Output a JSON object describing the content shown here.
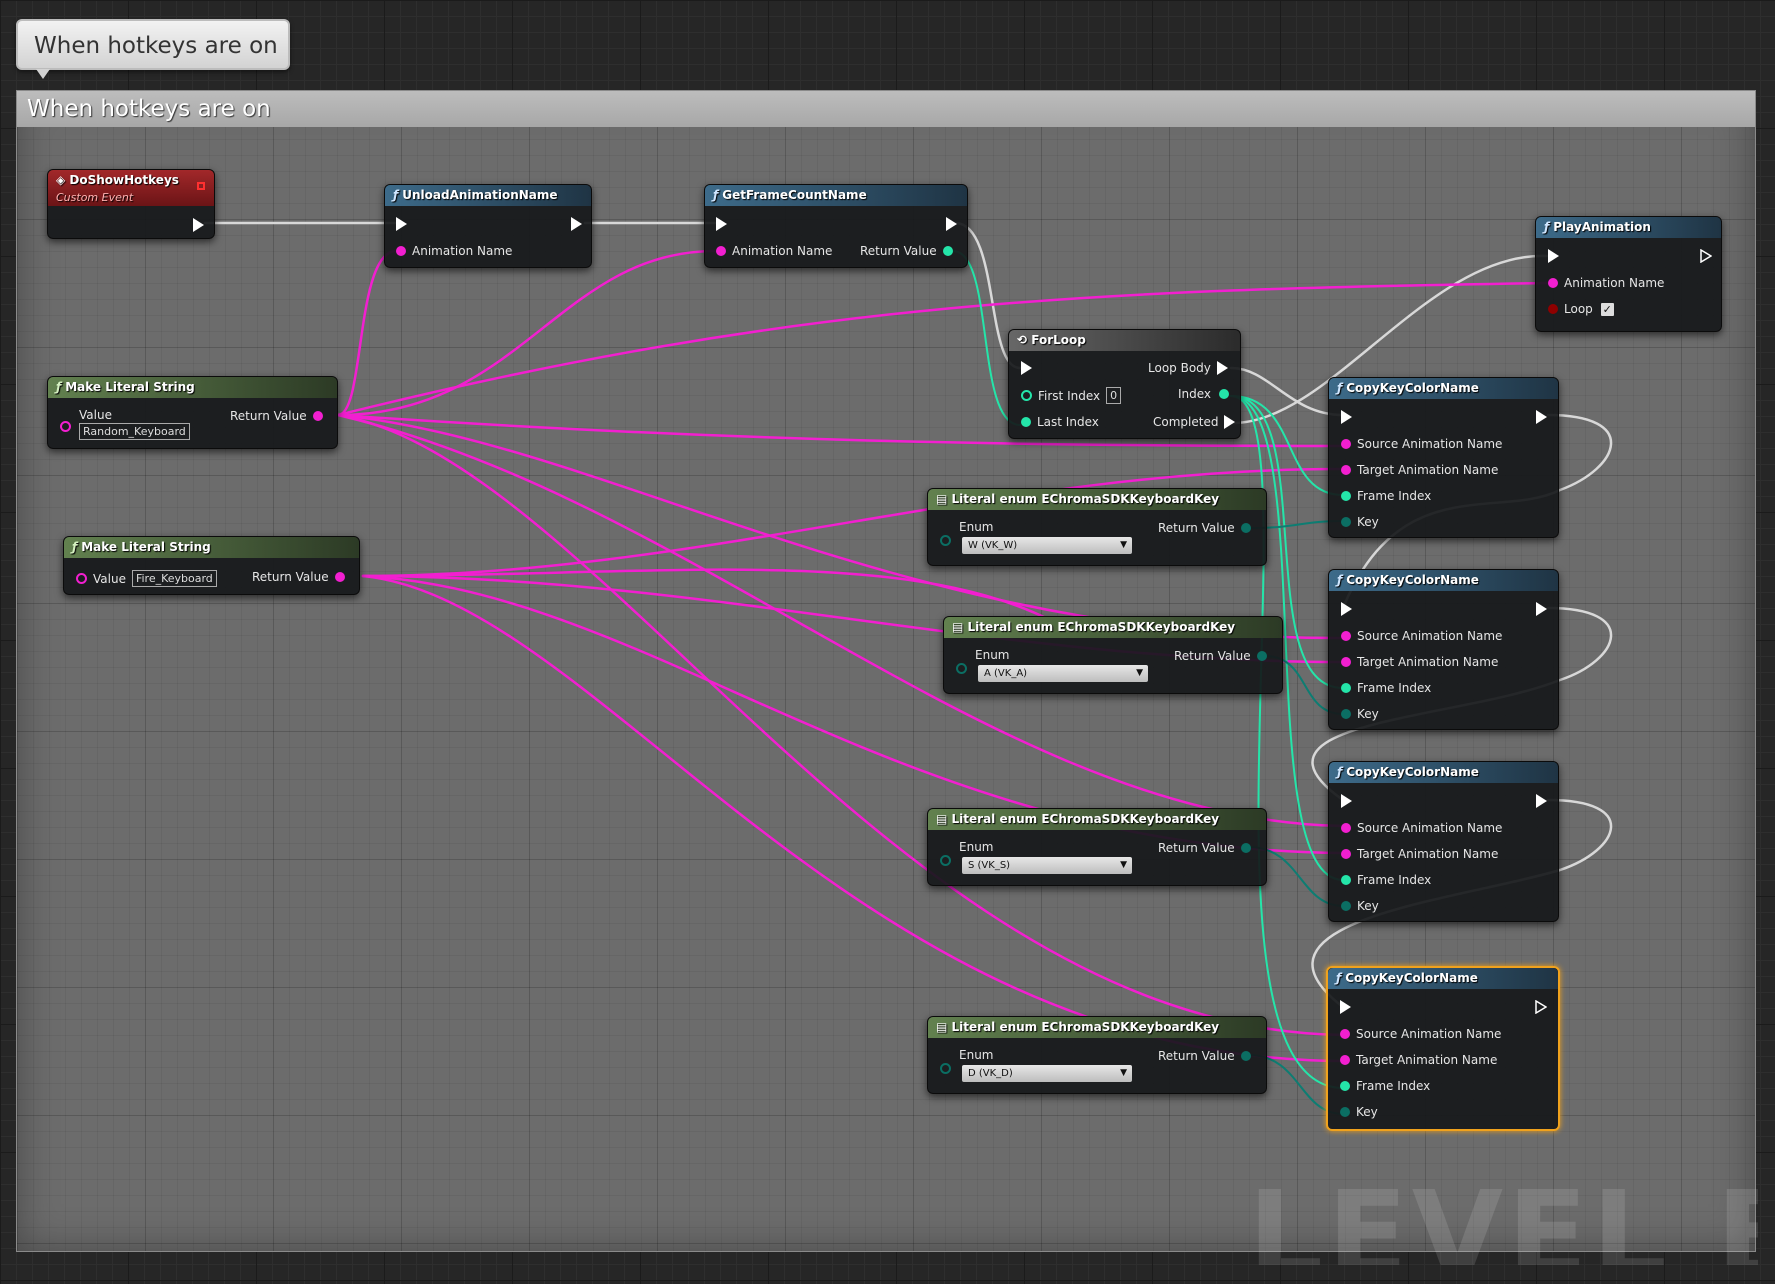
{
  "bubble": {
    "text": "When hotkeys are on"
  },
  "comment": {
    "title": "When hotkeys are on"
  },
  "watermark": "LEVEL BLU",
  "colors": {
    "string_pin": "#f21fd0",
    "int_pin": "#24e5a9",
    "byte_pin": "#0b6e63",
    "selection": "#f0a21d"
  },
  "nodes": {
    "event": {
      "title": "DoShowHotkeys",
      "subtitle": "Custom Event"
    },
    "unload": {
      "title": "UnloadAnimationName",
      "pin_anim": "Animation Name"
    },
    "getframe": {
      "title": "GetFrameCountName",
      "pin_anim": "Animation Name",
      "pin_ret": "Return Value"
    },
    "play": {
      "title": "PlayAnimation",
      "pin_anim": "Animation Name",
      "pin_loop": "Loop",
      "loop_checked": "✓"
    },
    "forloop": {
      "title": "ForLoop",
      "loop_body": "Loop Body",
      "first_index": "First Index",
      "first_index_value": "0",
      "index": "Index",
      "last_index": "Last Index",
      "completed": "Completed"
    },
    "mls1": {
      "title": "Make Literal String",
      "value_label": "Value",
      "value": "Random_Keyboard",
      "ret": "Return Value"
    },
    "mls2": {
      "title": "Make Literal String",
      "value_label": "Value",
      "value": "Fire_Keyboard",
      "ret": "Return Value"
    },
    "enums": [
      {
        "title": "Literal enum EChromaSDKKeyboardKey",
        "enum_label": "Enum",
        "ret": "Return Value",
        "value": "W (VK_W)"
      },
      {
        "title": "Literal enum EChromaSDKKeyboardKey",
        "enum_label": "Enum",
        "ret": "Return Value",
        "value": "A (VK_A)"
      },
      {
        "title": "Literal enum EChromaSDKKeyboardKey",
        "enum_label": "Enum",
        "ret": "Return Value",
        "value": "S (VK_S)"
      },
      {
        "title": "Literal enum EChromaSDKKeyboardKey",
        "enum_label": "Enum",
        "ret": "Return Value",
        "value": "D (VK_D)"
      }
    ],
    "copy": [
      {
        "title": "CopyKeyColorName",
        "src": "Source Animation Name",
        "tgt": "Target Animation Name",
        "frame": "Frame Index",
        "key": "Key"
      },
      {
        "title": "CopyKeyColorName",
        "src": "Source Animation Name",
        "tgt": "Target Animation Name",
        "frame": "Frame Index",
        "key": "Key"
      },
      {
        "title": "CopyKeyColorName",
        "src": "Source Animation Name",
        "tgt": "Target Animation Name",
        "frame": "Frame Index",
        "key": "Key"
      },
      {
        "title": "CopyKeyColorName",
        "src": "Source Animation Name",
        "tgt": "Target Animation Name",
        "frame": "Frame Index",
        "key": "Key"
      }
    ]
  }
}
